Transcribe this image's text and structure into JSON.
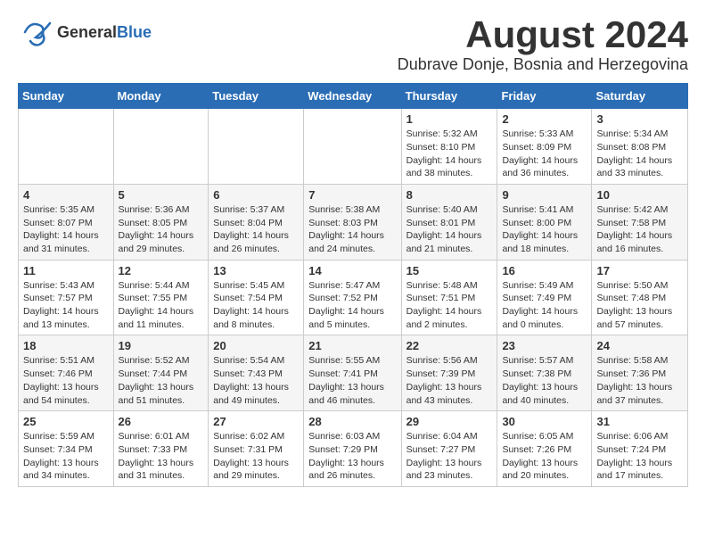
{
  "header": {
    "logo_general": "General",
    "logo_blue": "Blue",
    "month_title": "August 2024",
    "location": "Dubrave Donje, Bosnia and Herzegovina"
  },
  "calendar": {
    "days_of_week": [
      "Sunday",
      "Monday",
      "Tuesday",
      "Wednesday",
      "Thursday",
      "Friday",
      "Saturday"
    ],
    "weeks": [
      [
        {
          "day": "",
          "info": ""
        },
        {
          "day": "",
          "info": ""
        },
        {
          "day": "",
          "info": ""
        },
        {
          "day": "",
          "info": ""
        },
        {
          "day": "1",
          "info": "Sunrise: 5:32 AM\nSunset: 8:10 PM\nDaylight: 14 hours\nand 38 minutes."
        },
        {
          "day": "2",
          "info": "Sunrise: 5:33 AM\nSunset: 8:09 PM\nDaylight: 14 hours\nand 36 minutes."
        },
        {
          "day": "3",
          "info": "Sunrise: 5:34 AM\nSunset: 8:08 PM\nDaylight: 14 hours\nand 33 minutes."
        }
      ],
      [
        {
          "day": "4",
          "info": "Sunrise: 5:35 AM\nSunset: 8:07 PM\nDaylight: 14 hours\nand 31 minutes."
        },
        {
          "day": "5",
          "info": "Sunrise: 5:36 AM\nSunset: 8:05 PM\nDaylight: 14 hours\nand 29 minutes."
        },
        {
          "day": "6",
          "info": "Sunrise: 5:37 AM\nSunset: 8:04 PM\nDaylight: 14 hours\nand 26 minutes."
        },
        {
          "day": "7",
          "info": "Sunrise: 5:38 AM\nSunset: 8:03 PM\nDaylight: 14 hours\nand 24 minutes."
        },
        {
          "day": "8",
          "info": "Sunrise: 5:40 AM\nSunset: 8:01 PM\nDaylight: 14 hours\nand 21 minutes."
        },
        {
          "day": "9",
          "info": "Sunrise: 5:41 AM\nSunset: 8:00 PM\nDaylight: 14 hours\nand 18 minutes."
        },
        {
          "day": "10",
          "info": "Sunrise: 5:42 AM\nSunset: 7:58 PM\nDaylight: 14 hours\nand 16 minutes."
        }
      ],
      [
        {
          "day": "11",
          "info": "Sunrise: 5:43 AM\nSunset: 7:57 PM\nDaylight: 14 hours\nand 13 minutes."
        },
        {
          "day": "12",
          "info": "Sunrise: 5:44 AM\nSunset: 7:55 PM\nDaylight: 14 hours\nand 11 minutes."
        },
        {
          "day": "13",
          "info": "Sunrise: 5:45 AM\nSunset: 7:54 PM\nDaylight: 14 hours\nand 8 minutes."
        },
        {
          "day": "14",
          "info": "Sunrise: 5:47 AM\nSunset: 7:52 PM\nDaylight: 14 hours\nand 5 minutes."
        },
        {
          "day": "15",
          "info": "Sunrise: 5:48 AM\nSunset: 7:51 PM\nDaylight: 14 hours\nand 2 minutes."
        },
        {
          "day": "16",
          "info": "Sunrise: 5:49 AM\nSunset: 7:49 PM\nDaylight: 14 hours\nand 0 minutes."
        },
        {
          "day": "17",
          "info": "Sunrise: 5:50 AM\nSunset: 7:48 PM\nDaylight: 13 hours\nand 57 minutes."
        }
      ],
      [
        {
          "day": "18",
          "info": "Sunrise: 5:51 AM\nSunset: 7:46 PM\nDaylight: 13 hours\nand 54 minutes."
        },
        {
          "day": "19",
          "info": "Sunrise: 5:52 AM\nSunset: 7:44 PM\nDaylight: 13 hours\nand 51 minutes."
        },
        {
          "day": "20",
          "info": "Sunrise: 5:54 AM\nSunset: 7:43 PM\nDaylight: 13 hours\nand 49 minutes."
        },
        {
          "day": "21",
          "info": "Sunrise: 5:55 AM\nSunset: 7:41 PM\nDaylight: 13 hours\nand 46 minutes."
        },
        {
          "day": "22",
          "info": "Sunrise: 5:56 AM\nSunset: 7:39 PM\nDaylight: 13 hours\nand 43 minutes."
        },
        {
          "day": "23",
          "info": "Sunrise: 5:57 AM\nSunset: 7:38 PM\nDaylight: 13 hours\nand 40 minutes."
        },
        {
          "day": "24",
          "info": "Sunrise: 5:58 AM\nSunset: 7:36 PM\nDaylight: 13 hours\nand 37 minutes."
        }
      ],
      [
        {
          "day": "25",
          "info": "Sunrise: 5:59 AM\nSunset: 7:34 PM\nDaylight: 13 hours\nand 34 minutes."
        },
        {
          "day": "26",
          "info": "Sunrise: 6:01 AM\nSunset: 7:33 PM\nDaylight: 13 hours\nand 31 minutes."
        },
        {
          "day": "27",
          "info": "Sunrise: 6:02 AM\nSunset: 7:31 PM\nDaylight: 13 hours\nand 29 minutes."
        },
        {
          "day": "28",
          "info": "Sunrise: 6:03 AM\nSunset: 7:29 PM\nDaylight: 13 hours\nand 26 minutes."
        },
        {
          "day": "29",
          "info": "Sunrise: 6:04 AM\nSunset: 7:27 PM\nDaylight: 13 hours\nand 23 minutes."
        },
        {
          "day": "30",
          "info": "Sunrise: 6:05 AM\nSunset: 7:26 PM\nDaylight: 13 hours\nand 20 minutes."
        },
        {
          "day": "31",
          "info": "Sunrise: 6:06 AM\nSunset: 7:24 PM\nDaylight: 13 hours\nand 17 minutes."
        }
      ]
    ]
  }
}
